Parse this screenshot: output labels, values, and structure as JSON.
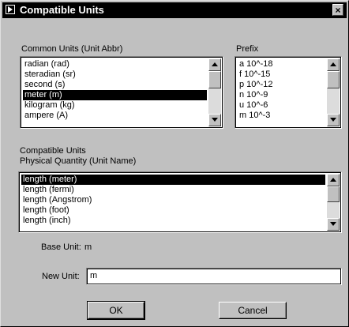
{
  "window": {
    "title": "Compatible Units",
    "close_glyph": "×"
  },
  "common_units": {
    "label": "Common Units (Unit Abbr)",
    "items": [
      "radian (rad)",
      "steradian (sr)",
      "second (s)",
      "meter (m)",
      "kilogram (kg)",
      "ampere (A)"
    ],
    "selected_index": 3
  },
  "prefix": {
    "label": "Prefix",
    "items": [
      "a  10^-18",
      "f  10^-15",
      "p  10^-12",
      "n  10^-9",
      "u  10^-6",
      "m  10^-3"
    ]
  },
  "compatible": {
    "label_line1": "Compatible Units",
    "label_line2": "Physical Quantity (Unit Name)",
    "items": [
      "length (meter)",
      "length (fermi)",
      "length (Angstrom)",
      "length (foot)",
      "length (inch)"
    ],
    "selected_index": 0
  },
  "base_unit": {
    "label": "Base Unit:",
    "value": "m"
  },
  "new_unit": {
    "label": "New Unit:",
    "value": "m"
  },
  "buttons": {
    "ok": "OK",
    "cancel": "Cancel"
  }
}
